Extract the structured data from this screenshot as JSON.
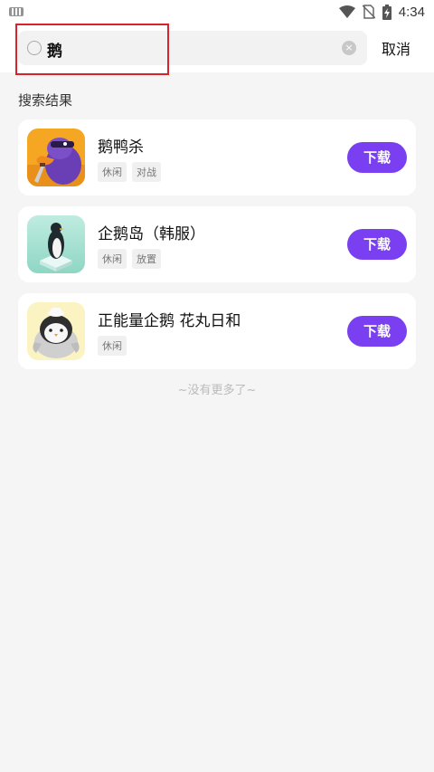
{
  "status_bar": {
    "time": "4:34"
  },
  "search": {
    "query": "鹅",
    "cancel_label": "取消"
  },
  "results": {
    "section_title": "搜索结果",
    "download_label": "下载",
    "items": [
      {
        "name": "鹅鸭杀",
        "tags": [
          "休闲",
          "对战"
        ],
        "icon": "duck-goose-icon"
      },
      {
        "name": "企鹅岛（韩服）",
        "tags": [
          "休闲",
          "放置"
        ],
        "icon": "penguin-isle-icon"
      },
      {
        "name": "正能量企鹅 花丸日和",
        "tags": [
          "休闲"
        ],
        "icon": "positive-penguin-icon"
      }
    ],
    "no_more_text": "~没有更多了~"
  },
  "colors": {
    "accent": "#7a3ff0",
    "highlight": "#d8232a"
  }
}
